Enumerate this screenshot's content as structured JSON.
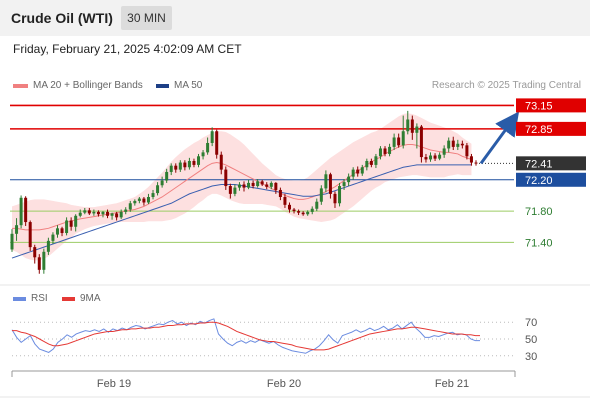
{
  "header": {
    "instrument": "Crude Oil (WTI)",
    "timeframe": "30 MIN",
    "datetime": "Friday, February 21, 2025 4:02:09 AM CET"
  },
  "legend": {
    "ma20_label": "MA 20 + Bollinger Bands",
    "ma50_label": "MA 50",
    "credit": "Research © 2025 Trading Central"
  },
  "colors": {
    "candle_up": "#2e7d32",
    "candle_down": "#8b0000",
    "resistance": "#e00000",
    "pivot": "#1d4e9e",
    "support": "#9ccc65",
    "ma20": "#f08080",
    "ma50": "#3a5fb0",
    "bollinger_fill": "#fde0e0",
    "rsi": "#6b8ce0",
    "rsi_ma": "#e53935",
    "arrow": "#2a5ca8"
  },
  "chart_data": [
    {
      "type": "candlestick",
      "ylim": [
        70.92,
        73.27
      ],
      "x_ticks": [
        "Feb 19",
        "Feb 20",
        "Feb 21"
      ],
      "current_price": "72.41",
      "levels": [
        {
          "label": "73.15",
          "value": 73.15,
          "kind": "resistance"
        },
        {
          "label": "72.85",
          "value": 72.85,
          "kind": "resistance"
        },
        {
          "label": "72.20",
          "value": 72.2,
          "kind": "pivot"
        },
        {
          "label": "71.80",
          "value": 71.8,
          "kind": "support"
        },
        {
          "label": "71.40",
          "value": 71.4,
          "kind": "support"
        }
      ],
      "arrow_target": 72.95,
      "candles": [
        [
          71.31,
          71.51,
          71.57,
          71.28
        ],
        [
          71.51,
          71.62,
          71.71,
          71.42
        ],
        [
          71.62,
          71.97,
          72.0,
          71.58
        ],
        [
          71.97,
          71.66,
          71.99,
          71.61
        ],
        [
          71.66,
          71.34,
          71.68,
          71.29
        ],
        [
          71.34,
          71.21,
          71.37,
          71.13
        ],
        [
          71.21,
          71.05,
          71.25,
          71.0
        ],
        [
          71.05,
          71.28,
          71.32,
          71.0
        ],
        [
          71.28,
          71.42,
          71.46,
          71.24
        ],
        [
          71.42,
          71.5,
          71.53,
          71.38
        ],
        [
          71.5,
          71.58,
          71.62,
          71.46
        ],
        [
          71.58,
          71.52,
          71.6,
          71.48
        ],
        [
          71.52,
          71.68,
          71.72,
          71.49
        ],
        [
          71.68,
          71.6,
          71.72,
          71.55
        ],
        [
          71.6,
          71.74,
          71.76,
          71.54
        ],
        [
          71.74,
          71.78,
          71.82,
          71.72
        ],
        [
          71.78,
          71.81,
          71.84,
          71.76
        ],
        [
          71.81,
          71.77,
          71.84,
          71.75
        ],
        [
          71.77,
          71.79,
          71.82,
          71.74
        ],
        [
          71.79,
          71.76,
          71.81,
          71.73
        ],
        [
          71.76,
          71.79,
          71.8,
          71.72
        ],
        [
          71.79,
          71.74,
          71.82,
          71.71
        ],
        [
          71.74,
          71.77,
          71.78,
          71.69
        ],
        [
          71.77,
          71.72,
          71.79,
          71.68
        ],
        [
          71.72,
          71.79,
          71.82,
          71.7
        ],
        [
          71.79,
          71.82,
          71.85,
          71.76
        ],
        [
          71.82,
          71.9,
          71.93,
          71.79
        ],
        [
          71.9,
          71.93,
          71.95,
          71.87
        ],
        [
          71.93,
          71.96,
          71.98,
          71.9
        ],
        [
          71.96,
          71.91,
          71.98,
          71.87
        ],
        [
          71.91,
          71.98,
          72.02,
          71.89
        ],
        [
          71.98,
          72.03,
          72.07,
          71.95
        ],
        [
          72.03,
          72.13,
          72.17,
          72.0
        ],
        [
          72.13,
          72.19,
          72.24,
          72.1
        ],
        [
          72.19,
          72.3,
          72.34,
          72.16
        ],
        [
          72.3,
          72.38,
          72.41,
          72.26
        ],
        [
          72.38,
          72.33,
          72.41,
          72.29
        ],
        [
          72.33,
          72.42,
          72.45,
          72.3
        ],
        [
          72.42,
          72.36,
          72.45,
          72.32
        ],
        [
          72.36,
          72.44,
          72.48,
          72.33
        ],
        [
          72.44,
          72.39,
          72.47,
          72.36
        ],
        [
          72.39,
          72.5,
          72.53,
          72.36
        ],
        [
          72.5,
          72.55,
          72.58,
          72.46
        ],
        [
          72.55,
          72.67,
          72.74,
          72.52
        ],
        [
          72.67,
          72.82,
          72.87,
          72.63
        ],
        [
          72.82,
          72.52,
          72.84,
          72.47
        ],
        [
          72.52,
          72.33,
          72.56,
          72.27
        ],
        [
          72.33,
          72.12,
          72.37,
          72.07
        ],
        [
          72.12,
          72.02,
          72.15,
          71.96
        ],
        [
          72.02,
          72.1,
          72.14,
          71.99
        ],
        [
          72.1,
          72.14,
          72.17,
          72.06
        ],
        [
          72.14,
          72.1,
          72.18,
          72.05
        ],
        [
          72.1,
          72.16,
          72.2,
          72.08
        ],
        [
          72.16,
          72.12,
          72.19,
          72.09
        ],
        [
          72.12,
          72.18,
          72.21,
          72.1
        ],
        [
          72.18,
          72.14,
          72.2,
          72.12
        ],
        [
          72.14,
          72.11,
          72.17,
          72.08
        ],
        [
          72.11,
          72.16,
          72.18,
          72.08
        ],
        [
          72.16,
          72.07,
          72.17,
          72.02
        ],
        [
          72.07,
          71.98,
          72.1,
          71.94
        ],
        [
          71.98,
          71.88,
          72.02,
          71.84
        ],
        [
          71.88,
          71.82,
          71.91,
          71.78
        ],
        [
          71.82,
          71.8,
          71.84,
          71.77
        ],
        [
          71.8,
          71.78,
          71.82,
          71.75
        ],
        [
          71.78,
          71.76,
          71.8,
          71.74
        ],
        [
          71.76,
          71.79,
          71.81,
          71.74
        ],
        [
          71.79,
          71.83,
          71.86,
          71.76
        ],
        [
          71.83,
          71.92,
          71.96,
          71.8
        ],
        [
          71.92,
          72.09,
          72.13,
          71.88
        ],
        [
          72.09,
          72.27,
          72.32,
          72.04
        ],
        [
          72.27,
          72.02,
          72.29,
          71.96
        ],
        [
          72.02,
          71.9,
          72.05,
          71.84
        ],
        [
          71.9,
          72.12,
          72.16,
          71.86
        ],
        [
          72.12,
          72.17,
          72.21,
          72.07
        ],
        [
          72.17,
          72.24,
          72.28,
          72.12
        ],
        [
          72.24,
          72.33,
          72.36,
          72.2
        ],
        [
          72.33,
          72.28,
          72.37,
          72.24
        ],
        [
          72.28,
          72.36,
          72.39,
          72.25
        ],
        [
          72.36,
          72.44,
          72.47,
          72.32
        ],
        [
          72.44,
          72.39,
          72.47,
          72.36
        ],
        [
          72.39,
          72.5,
          72.53,
          72.35
        ],
        [
          72.5,
          72.6,
          72.63,
          72.46
        ],
        [
          72.6,
          72.53,
          72.63,
          72.5
        ],
        [
          72.53,
          72.62,
          72.66,
          72.5
        ],
        [
          72.62,
          72.74,
          72.79,
          72.58
        ],
        [
          72.74,
          72.64,
          72.79,
          72.61
        ],
        [
          72.64,
          72.82,
          73.02,
          72.6
        ],
        [
          72.82,
          72.97,
          73.08,
          72.78
        ],
        [
          72.97,
          72.8,
          73.02,
          72.71
        ],
        [
          72.8,
          72.88,
          72.92,
          72.6
        ],
        [
          72.88,
          72.49,
          72.9,
          72.42
        ],
        [
          72.49,
          72.46,
          72.53,
          72.42
        ],
        [
          72.46,
          72.51,
          72.55,
          72.43
        ],
        [
          72.51,
          72.47,
          72.54,
          72.44
        ],
        [
          72.47,
          72.52,
          72.55,
          72.45
        ],
        [
          72.52,
          72.6,
          72.64,
          72.48
        ],
        [
          72.6,
          72.7,
          72.74,
          72.55
        ],
        [
          72.7,
          72.62,
          72.75,
          72.58
        ],
        [
          72.62,
          72.66,
          72.71,
          72.58
        ],
        [
          72.66,
          72.64,
          72.7,
          72.6
        ],
        [
          72.64,
          72.5,
          72.67,
          72.46
        ],
        [
          72.5,
          72.42,
          72.53,
          72.38
        ],
        [
          72.42,
          72.41,
          72.45,
          72.38
        ]
      ],
      "ma20": [
        71.58,
        71.58,
        71.57,
        71.56,
        71.56,
        71.56,
        71.56,
        71.57,
        71.58,
        71.6,
        71.62,
        71.64,
        71.66,
        71.67,
        71.69,
        71.7,
        71.71,
        71.72,
        71.73,
        71.74,
        71.75,
        71.76,
        71.77,
        71.78,
        71.79,
        71.8,
        71.81,
        71.82,
        71.84,
        71.86,
        71.89,
        71.92,
        71.95,
        71.98,
        72.02,
        72.06,
        72.1,
        72.14,
        72.18,
        72.22,
        72.26,
        72.3,
        72.34,
        72.38,
        72.41,
        72.42,
        72.41,
        72.39,
        72.36,
        72.33,
        72.3,
        72.27,
        72.24,
        72.21,
        72.18,
        72.15,
        72.12,
        72.09,
        72.06,
        72.03,
        72.0,
        71.98,
        71.96,
        71.95,
        71.95,
        71.96,
        71.98,
        72.0,
        72.02,
        72.05,
        72.08,
        72.11,
        72.15,
        72.19,
        72.23,
        72.27,
        72.31,
        72.35,
        72.39,
        72.43,
        72.46,
        72.49,
        72.53,
        72.56,
        72.59,
        72.62,
        72.64,
        72.65,
        72.65,
        72.64,
        72.62,
        72.6,
        72.58,
        72.57,
        72.56,
        72.55,
        72.55,
        72.54,
        72.53,
        72.5,
        72.48,
        72.46
      ],
      "ma50": [
        71.2,
        71.22,
        71.24,
        71.26,
        71.28,
        71.3,
        71.32,
        71.34,
        71.36,
        71.38,
        71.4,
        71.42,
        71.44,
        71.46,
        71.48,
        71.5,
        71.52,
        71.54,
        71.56,
        71.58,
        71.6,
        71.62,
        71.64,
        71.66,
        71.68,
        71.7,
        71.72,
        71.74,
        71.76,
        71.78,
        71.8,
        71.82,
        71.84,
        71.86,
        71.88,
        71.9,
        71.93,
        71.96,
        71.99,
        72.02,
        72.04,
        72.06,
        72.08,
        72.1,
        72.12,
        72.13,
        72.14,
        72.14,
        72.14,
        72.14,
        72.13,
        72.12,
        72.11,
        72.1,
        72.09,
        72.08,
        72.07,
        72.06,
        72.05,
        72.04,
        72.03,
        72.02,
        72.01,
        72.0,
        71.99,
        71.99,
        71.99,
        72.0,
        72.01,
        72.02,
        72.04,
        72.06,
        72.08,
        72.1,
        72.12,
        72.14,
        72.16,
        72.18,
        72.2,
        72.22,
        72.24,
        72.26,
        72.28,
        72.3,
        72.32,
        72.34,
        72.36,
        72.37,
        72.38,
        72.39,
        72.39,
        72.39,
        72.39,
        72.39,
        72.39,
        72.39,
        72.39,
        72.39,
        72.39,
        72.39,
        72.39,
        72.39
      ],
      "bb_width": [
        0.28,
        0.3,
        0.33,
        0.36,
        0.38,
        0.39,
        0.39,
        0.38,
        0.36,
        0.33,
        0.3,
        0.27,
        0.24,
        0.21,
        0.18,
        0.16,
        0.14,
        0.13,
        0.12,
        0.12,
        0.12,
        0.12,
        0.12,
        0.12,
        0.13,
        0.14,
        0.15,
        0.16,
        0.18,
        0.2,
        0.22,
        0.25,
        0.28,
        0.31,
        0.34,
        0.37,
        0.39,
        0.4,
        0.41,
        0.41,
        0.41,
        0.4,
        0.4,
        0.39,
        0.39,
        0.4,
        0.41,
        0.42,
        0.42,
        0.41,
        0.4,
        0.38,
        0.35,
        0.32,
        0.29,
        0.26,
        0.24,
        0.22,
        0.2,
        0.2,
        0.21,
        0.22,
        0.23,
        0.24,
        0.25,
        0.27,
        0.3,
        0.33,
        0.36,
        0.38,
        0.4,
        0.41,
        0.41,
        0.41,
        0.41,
        0.41,
        0.4,
        0.39,
        0.38,
        0.37,
        0.36,
        0.36,
        0.36,
        0.37,
        0.38,
        0.39,
        0.4,
        0.4,
        0.39,
        0.38,
        0.37,
        0.36,
        0.35,
        0.34,
        0.33,
        0.32,
        0.3,
        0.28,
        0.26,
        0.24,
        0.22,
        0.2
      ]
    },
    {
      "type": "line",
      "ylim": [
        25,
        75
      ],
      "y_ticks": [
        70,
        50,
        30
      ],
      "series": [
        {
          "name": "RSI",
          "values": [
            61,
            52,
            46,
            50,
            54,
            44,
            38,
            36,
            34,
            38,
            46,
            50,
            55,
            52,
            56,
            58,
            60,
            59,
            61,
            59,
            62,
            58,
            62,
            60,
            63,
            61,
            64,
            66,
            65,
            62,
            64,
            66,
            68,
            67,
            70,
            72,
            68,
            70,
            66,
            69,
            67,
            71,
            69,
            72,
            74,
            56,
            50,
            45,
            42,
            46,
            48,
            45,
            48,
            46,
            49,
            47,
            45,
            47,
            43,
            40,
            38,
            36,
            35,
            34,
            33,
            36,
            38,
            42,
            48,
            55,
            49,
            45,
            54,
            56,
            58,
            61,
            58,
            60,
            63,
            60,
            62,
            65,
            61,
            63,
            67,
            62,
            66,
            70,
            63,
            58,
            52,
            52,
            54,
            53,
            55,
            57,
            58,
            55,
            56,
            55,
            50,
            48,
            48
          ]
        },
        {
          "name": "9MA",
          "values": [
            60,
            60,
            58,
            57,
            55,
            53,
            50,
            47,
            44,
            42,
            42,
            43,
            44,
            46,
            48,
            50,
            52,
            54,
            56,
            57,
            58,
            59,
            59,
            60,
            61,
            61,
            62,
            62,
            63,
            63,
            63,
            64,
            64,
            65,
            66,
            66,
            67,
            67,
            68,
            68,
            68,
            69,
            69,
            70,
            70,
            69,
            67,
            65,
            62,
            59,
            57,
            55,
            53,
            51,
            49,
            48,
            47,
            47,
            46,
            45,
            44,
            43,
            41,
            40,
            39,
            38,
            37,
            37,
            37,
            38,
            40,
            42,
            44,
            46,
            48,
            50,
            52,
            54,
            56,
            57,
            58,
            59,
            60,
            61,
            62,
            62,
            63,
            64,
            64,
            63,
            62,
            61,
            60,
            59,
            58,
            57,
            56,
            56,
            56,
            55,
            55,
            54,
            54
          ]
        }
      ]
    }
  ]
}
